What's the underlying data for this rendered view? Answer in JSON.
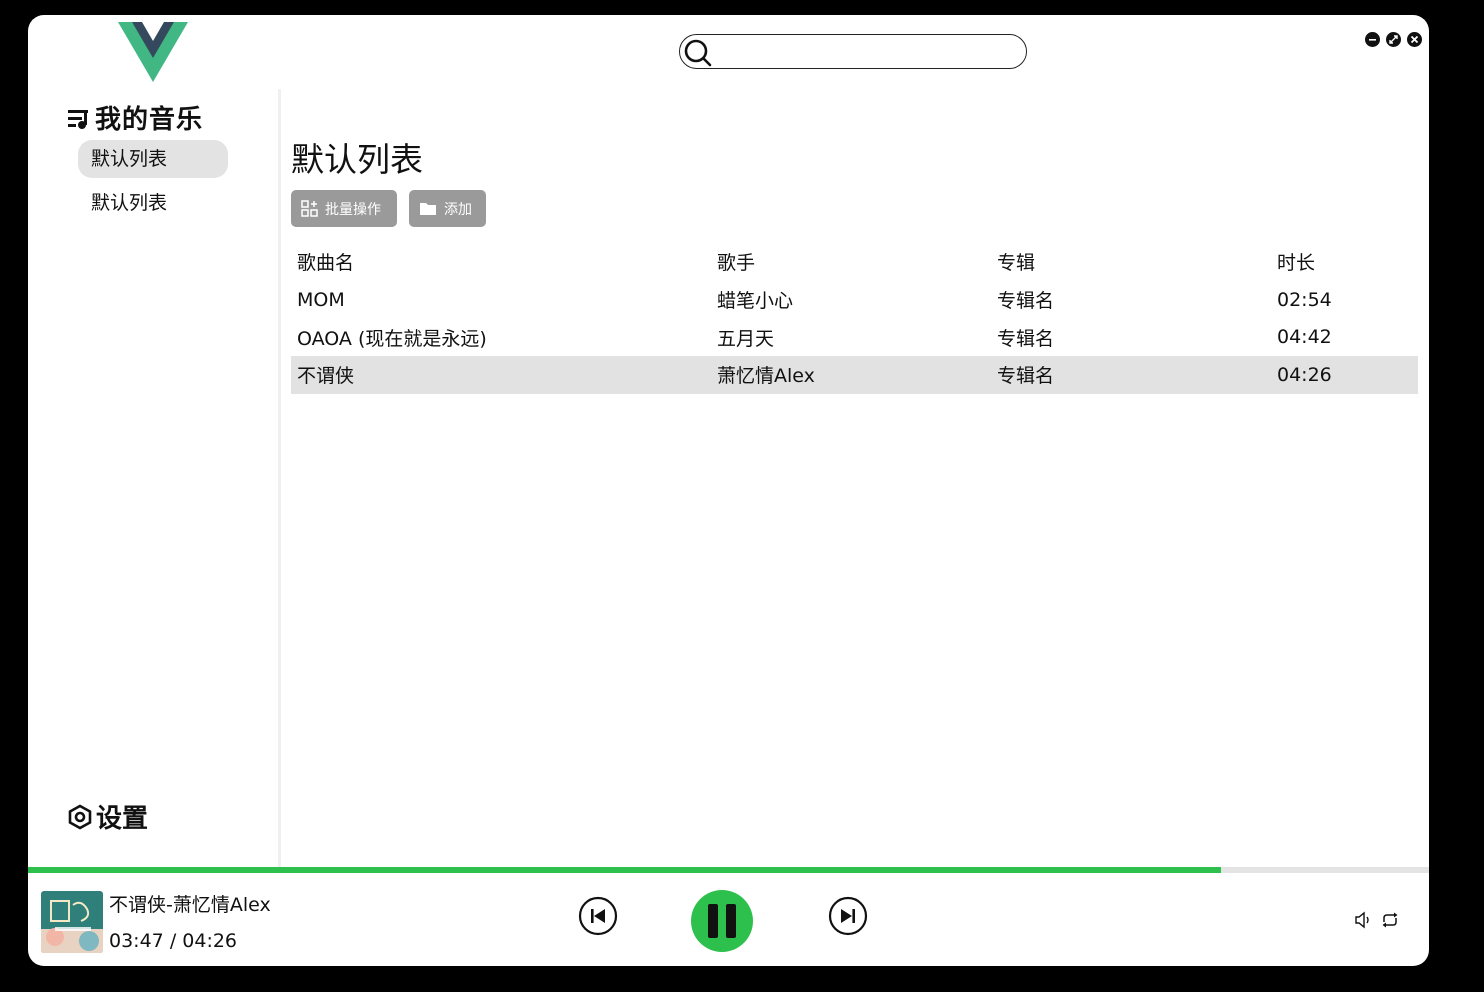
{
  "app": {
    "logo_icon": "vue-logo-icon",
    "brand_color": "#41b883",
    "brand_dark": "#35495e"
  },
  "search": {
    "placeholder": "",
    "value": ""
  },
  "window_controls": [
    "minimize-icon",
    "maximize-icon",
    "close-icon"
  ],
  "sidebar": {
    "section_title": "我的音乐",
    "items": [
      {
        "label": "默认列表",
        "active": true
      },
      {
        "label": "默认列表",
        "active": false
      }
    ],
    "settings_label": "设置"
  },
  "main": {
    "title": "默认列表",
    "buttons": {
      "batch_label": "批量操作",
      "add_label": "添加"
    },
    "table": {
      "headers": [
        "歌曲名",
        "歌手",
        "专辑",
        "时长"
      ],
      "rows": [
        [
          "MOM",
          "蜡笔小心",
          "专辑名",
          "02:54"
        ],
        [
          "OAOA (现在就是永远)",
          "五月天",
          "专辑名",
          "04:42"
        ],
        [
          "不谓侠",
          "萧忆情Alex",
          "专辑名",
          "04:26"
        ]
      ],
      "playing_row": 2
    }
  },
  "player": {
    "now_playing": "不谓侠-萧忆情Alex",
    "current_time": "03:47",
    "separator": "/",
    "total_time": "04:26",
    "progress": 0.8515,
    "accent": "#2ec04d",
    "state": "playing"
  }
}
